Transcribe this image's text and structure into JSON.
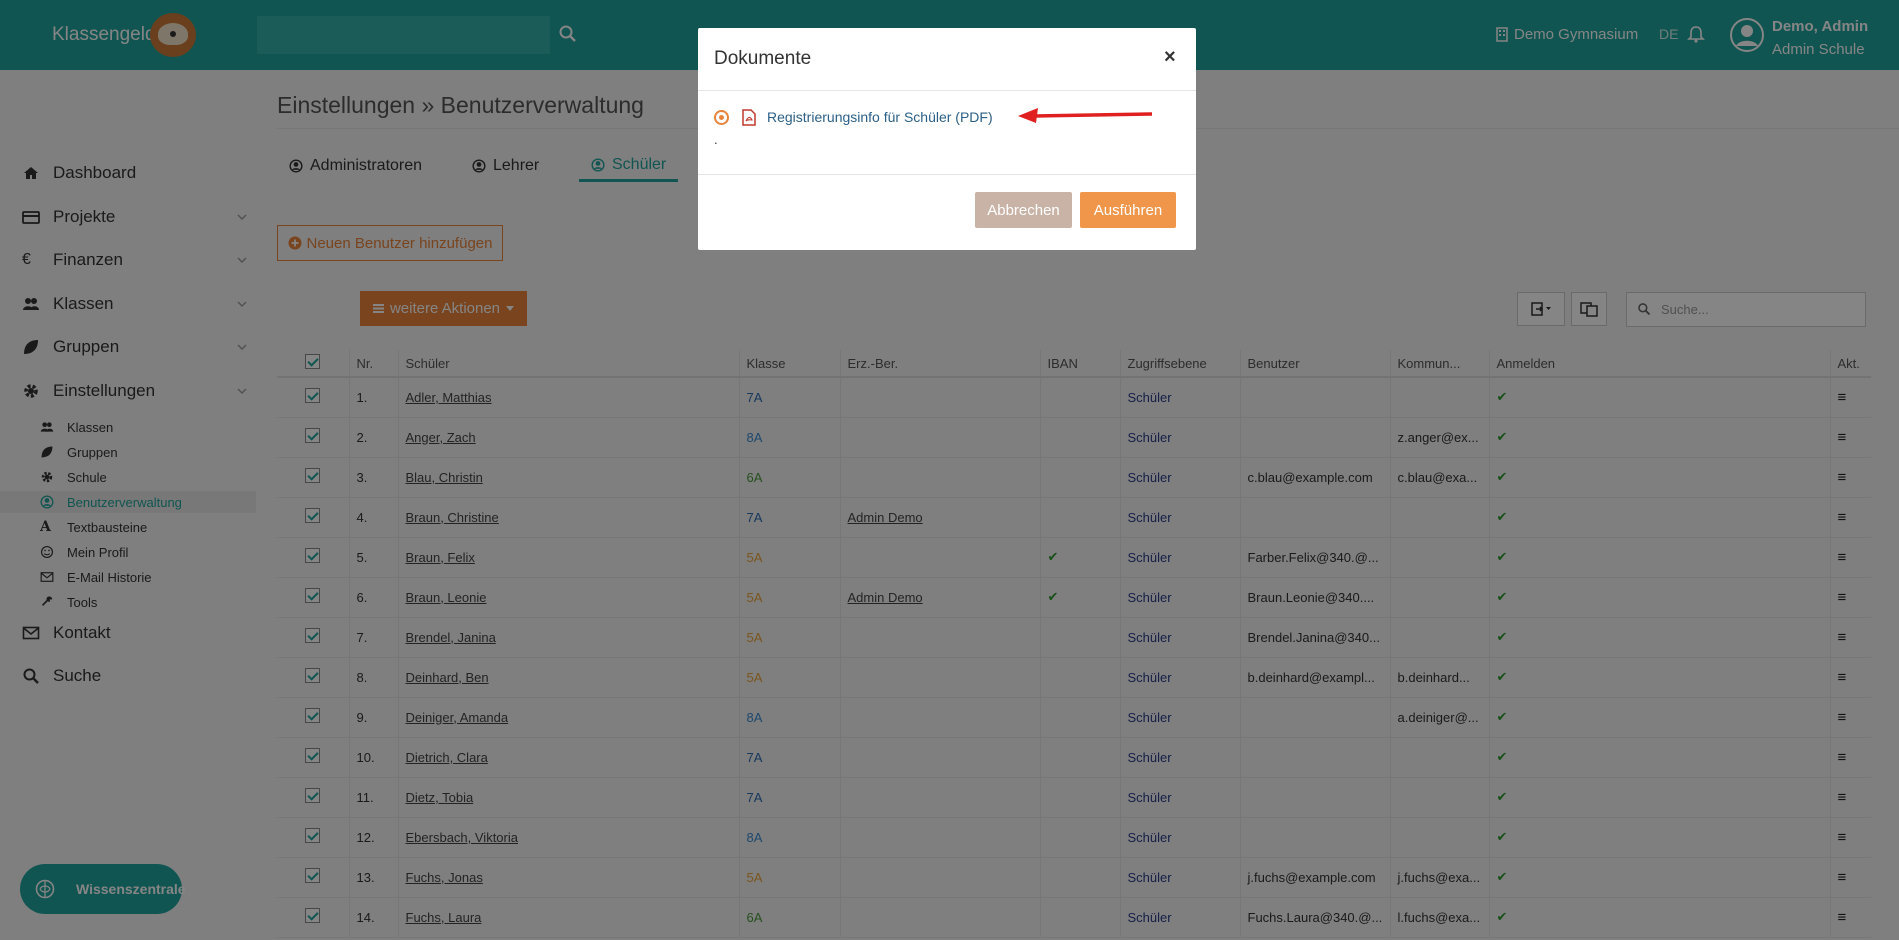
{
  "topbar": {
    "brand": "Klassengeld",
    "search_value": "",
    "school": "Demo Gymnasium",
    "lang": "DE",
    "user_name": "Demo, Admin",
    "user_role": "Admin Schule"
  },
  "sidebar": {
    "items": [
      {
        "label": "Dashboard",
        "icon": "home-icon"
      },
      {
        "label": "Projekte",
        "icon": "card-icon"
      },
      {
        "label": "Finanzen",
        "icon": "euro-icon"
      },
      {
        "label": "Klassen",
        "icon": "users-icon"
      },
      {
        "label": "Gruppen",
        "icon": "leaf-icon"
      },
      {
        "label": "Einstellungen",
        "icon": "gear-icon"
      }
    ],
    "sub_items": [
      {
        "label": "Klassen",
        "icon": "users-icon"
      },
      {
        "label": "Gruppen",
        "icon": "leaf-icon"
      },
      {
        "label": "Schule",
        "icon": "gear-icon"
      },
      {
        "label": "Benutzerverwaltung",
        "icon": "user-circle-icon"
      },
      {
        "label": "Textbausteine",
        "icon": "font-icon"
      },
      {
        "label": "Mein Profil",
        "icon": "smile-icon"
      },
      {
        "label": "E-Mail Historie",
        "icon": "envelope-icon"
      },
      {
        "label": "Tools",
        "icon": "wrench-icon"
      }
    ],
    "bottom_items": [
      {
        "label": "Kontakt",
        "icon": "envelope-icon"
      },
      {
        "label": "Suche",
        "icon": "search-icon"
      }
    ],
    "wissen": "Wissenszentrale"
  },
  "main": {
    "title": "Einstellungen » Benutzerverwaltung",
    "tabs": [
      "Administratoren",
      "Lehrer",
      "Schüler"
    ],
    "add_button": "Neuen Benutzer hinzufügen",
    "weitere_button": "weitere Aktionen",
    "search_placeholder": "Suche..."
  },
  "table": {
    "headers": [
      "",
      "Nr.",
      "Schüler",
      "Klasse",
      "Erz.-Ber.",
      "IBAN",
      "Zugriffsebene",
      "Benutzer",
      "Kommun...",
      "Anmelden",
      "Akt."
    ],
    "rows": [
      {
        "nr": "1.",
        "name": "Adler, Matthias",
        "klasse": "7A",
        "erz": "",
        "iban": "",
        "zugriff": "Schüler",
        "benutzer": "",
        "kommun": ""
      },
      {
        "nr": "2.",
        "name": "Anger, Zach",
        "klasse": "8A",
        "erz": "",
        "iban": "",
        "zugriff": "Schüler",
        "benutzer": "",
        "kommun": "z.anger@ex..."
      },
      {
        "nr": "3.",
        "name": "Blau, Christin",
        "klasse": "6A",
        "erz": "",
        "iban": "",
        "zugriff": "Schüler",
        "benutzer": "c.blau@example.com",
        "kommun": "c.blau@exa..."
      },
      {
        "nr": "4.",
        "name": "Braun, Christine",
        "klasse": "7A",
        "erz": "Admin Demo",
        "iban": "",
        "zugriff": "Schüler",
        "benutzer": "",
        "kommun": ""
      },
      {
        "nr": "5.",
        "name": "Braun, Felix",
        "klasse": "5A",
        "erz": "",
        "iban": "✔",
        "zugriff": "Schüler",
        "benutzer": "Farber.Felix@340.@...",
        "kommun": ""
      },
      {
        "nr": "6.",
        "name": "Braun, Leonie",
        "klasse": "5A",
        "erz": "Admin Demo",
        "iban": "✔",
        "zugriff": "Schüler",
        "benutzer": "Braun.Leonie@340....",
        "kommun": ""
      },
      {
        "nr": "7.",
        "name": "Brendel, Janina",
        "klasse": "5A",
        "erz": "",
        "iban": "",
        "zugriff": "Schüler",
        "benutzer": "Brendel.Janina@340...",
        "kommun": ""
      },
      {
        "nr": "8.",
        "name": "Deinhard, Ben",
        "klasse": "5A",
        "erz": "",
        "iban": "",
        "zugriff": "Schüler",
        "benutzer": "b.deinhard@exampl...",
        "kommun": "b.deinhard..."
      },
      {
        "nr": "9.",
        "name": "Deiniger, Amanda",
        "klasse": "8A",
        "erz": "",
        "iban": "",
        "zugriff": "Schüler",
        "benutzer": "",
        "kommun": "a.deiniger@..."
      },
      {
        "nr": "10.",
        "name": "Dietrich, Clara",
        "klasse": "7A",
        "erz": "",
        "iban": "",
        "zugriff": "Schüler",
        "benutzer": "",
        "kommun": ""
      },
      {
        "nr": "11.",
        "name": "Dietz, Tobia",
        "klasse": "7A",
        "erz": "",
        "iban": "",
        "zugriff": "Schüler",
        "benutzer": "",
        "kommun": ""
      },
      {
        "nr": "12.",
        "name": "Ebersbach, Viktoria",
        "klasse": "8A",
        "erz": "",
        "iban": "",
        "zugriff": "Schüler",
        "benutzer": "",
        "kommun": ""
      },
      {
        "nr": "13.",
        "name": "Fuchs, Jonas",
        "klasse": "5A",
        "erz": "",
        "iban": "",
        "zugriff": "Schüler",
        "benutzer": "j.fuchs@example.com",
        "kommun": "j.fuchs@exa..."
      },
      {
        "nr": "14.",
        "name": "Fuchs, Laura",
        "klasse": "6A",
        "erz": "",
        "iban": "",
        "zugriff": "Schüler",
        "benutzer": "Fuchs.Laura@340.@...",
        "kommun": "l.fuchs@exa..."
      }
    ],
    "klasse_colors": {
      "5A": "#e8a33a",
      "6A": "#4a9a3a",
      "7A": "#2a6ab0",
      "8A": "#3a8ad0"
    }
  },
  "modal": {
    "title": "Dokumente",
    "close": "×",
    "option": "Registrierungsinfo für Schüler (PDF)",
    "dot": ".",
    "cancel": "Abbrechen",
    "run": "Ausführen"
  },
  "colors": {
    "accent": "#1fa39b",
    "orange": "#e8833a",
    "arrow": "#e02020"
  }
}
